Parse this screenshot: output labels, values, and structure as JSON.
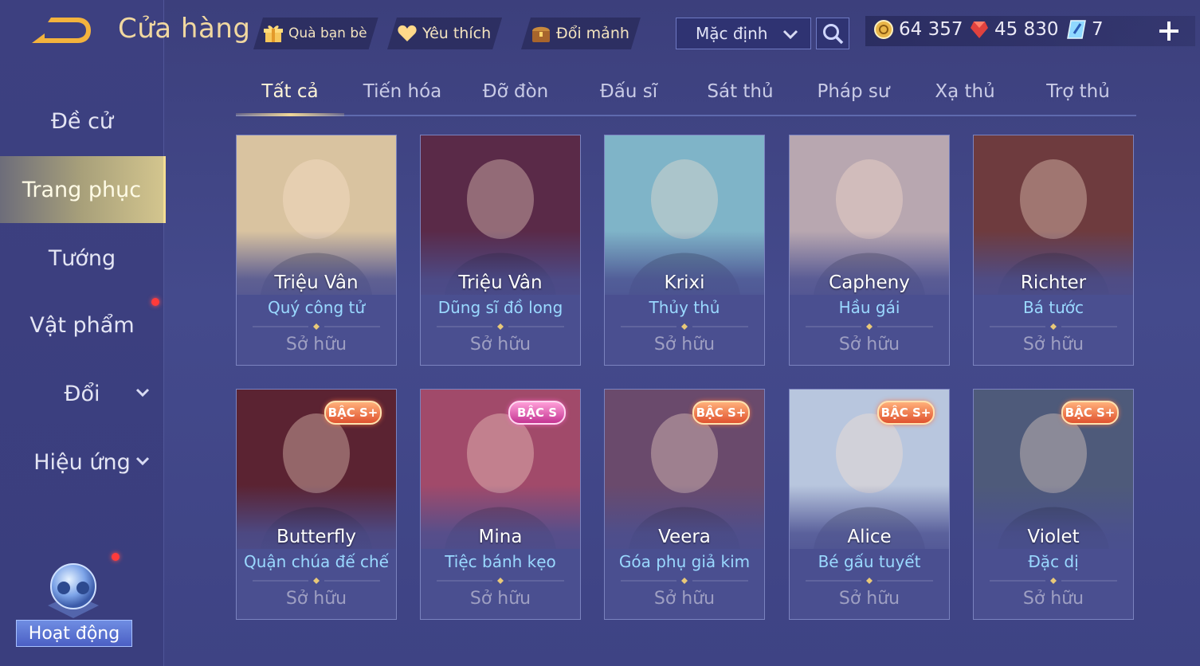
{
  "header": {
    "title": "Cửa hàng",
    "gift_label": "Quà bạn bè",
    "favorite_label": "Yêu thích",
    "exchange_label": "Đổi mảnh",
    "sort_value": "Mặc định",
    "gold": "64 357",
    "vouchers": "45 830",
    "diamonds": "7"
  },
  "sidebar": {
    "items": [
      {
        "label": "Đề cử"
      },
      {
        "label": "Trang phục"
      },
      {
        "label": "Tướng"
      },
      {
        "label": "Vật phẩm"
      },
      {
        "label": "Đổi"
      },
      {
        "label": "Hiệu ứng"
      }
    ],
    "event_label": "Hoạt động"
  },
  "tabs": [
    "Tất cả",
    "Tiến hóa",
    "Đỡ đòn",
    "Đấu sĩ",
    "Sát thủ",
    "Pháp sư",
    "Xạ thủ",
    "Trợ thủ"
  ],
  "cards": [
    {
      "hero": "Triệu Vân",
      "skin": "Quý công tử",
      "status": "Sở hữu",
      "badge": "",
      "art": "#d9c3a0"
    },
    {
      "hero": "Triệu Vân",
      "skin": "Dũng sĩ đồ long",
      "status": "Sở hữu",
      "badge": "",
      "art": "#5a2a48"
    },
    {
      "hero": "Krixi",
      "skin": "Thủy thủ",
      "status": "Sở hữu",
      "badge": "",
      "art": "#7fb4c8"
    },
    {
      "hero": "Capheny",
      "skin": "Hầu gái",
      "status": "Sở hữu",
      "badge": "",
      "art": "#b8a7b0"
    },
    {
      "hero": "Richter",
      "skin": "Bá tước",
      "status": "Sở hữu",
      "badge": "",
      "art": "#6e3b3e"
    },
    {
      "hero": "Butterfly",
      "skin": "Quận chúa đế chế",
      "status": "Sở hữu",
      "badge": "BẬC S+",
      "art": "#5b2332"
    },
    {
      "hero": "Mina",
      "skin": "Tiệc bánh kẹo",
      "status": "Sở hữu",
      "badge": "BẬC S",
      "art": "#a14a6a"
    },
    {
      "hero": "Veera",
      "skin": "Góa phụ giả kim",
      "status": "Sở hữu",
      "badge": "BẬC S+",
      "art": "#6a4a6c"
    },
    {
      "hero": "Alice",
      "skin": "Bé gấu tuyết",
      "status": "Sở hữu",
      "badge": "BẬC S+",
      "art": "#b8c6de"
    },
    {
      "hero": "Violet",
      "skin": "Đặc dị",
      "status": "Sở hữu",
      "badge": "BẬC S+",
      "art": "#4e5a7a"
    }
  ],
  "colors": {
    "accent_gold": "#f1d898",
    "skin_name_blue": "#9ad9ff",
    "badge_orange": "#e0522f",
    "badge_pink": "#c43592",
    "notification_red": "#ff3b3b"
  },
  "icons": [
    "back-arrow-icon",
    "gift-icon",
    "heart-icon",
    "chest-icon",
    "chevron-down-icon",
    "search-icon",
    "gold-coin-icon",
    "voucher-gem-icon",
    "diamond-icon",
    "plus-icon",
    "event-orb-icon"
  ]
}
